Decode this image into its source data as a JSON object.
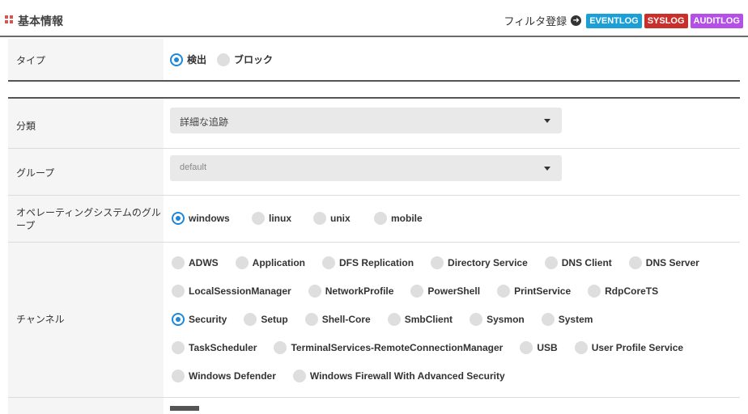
{
  "header": {
    "title": "基本情報",
    "filter_link": "フィルタ登録",
    "badges": [
      "EVENTLOG",
      "SYSLOG",
      "AUDITLOG"
    ]
  },
  "type_row": {
    "label": "タイプ",
    "options": [
      {
        "label": "検出",
        "selected": true
      },
      {
        "label": "ブロック",
        "selected": false
      }
    ]
  },
  "category_row": {
    "label": "分類",
    "selected": "詳細な追跡"
  },
  "group_row": {
    "label": "グループ",
    "selected": "default"
  },
  "os_row": {
    "label_line1": "オペレーティングシステムのグル",
    "label_line2": "ープ",
    "options": [
      {
        "label": "windows",
        "selected": true
      },
      {
        "label": "linux",
        "selected": false
      },
      {
        "label": "unix",
        "selected": false
      },
      {
        "label": "mobile",
        "selected": false
      }
    ]
  },
  "channel_row": {
    "label": "チャンネル",
    "lines": [
      [
        {
          "label": "ADWS",
          "selected": false
        },
        {
          "label": "Application",
          "selected": false
        },
        {
          "label": "DFS Replication",
          "selected": false
        },
        {
          "label": "Directory Service",
          "selected": false
        },
        {
          "label": "DNS Client",
          "selected": false
        },
        {
          "label": "DNS Server",
          "selected": false
        }
      ],
      [
        {
          "label": "LocalSessionManager",
          "selected": false
        },
        {
          "label": "NetworkProfile",
          "selected": false
        },
        {
          "label": "PowerShell",
          "selected": false
        },
        {
          "label": "PrintService",
          "selected": false
        },
        {
          "label": "RdpCoreTS",
          "selected": false
        }
      ],
      [
        {
          "label": "Security",
          "selected": true
        },
        {
          "label": "Setup",
          "selected": false
        },
        {
          "label": "Shell-Core",
          "selected": false
        },
        {
          "label": "SmbClient",
          "selected": false
        },
        {
          "label": "Sysmon",
          "selected": false
        },
        {
          "label": "System",
          "selected": false
        }
      ],
      [
        {
          "label": "TaskScheduler",
          "selected": false
        },
        {
          "label": "TerminalServices-RemoteConnectionManager",
          "selected": false
        },
        {
          "label": "USB",
          "selected": false
        },
        {
          "label": "User Profile Service",
          "selected": false
        }
      ],
      [
        {
          "label": "Windows Defender",
          "selected": false
        },
        {
          "label": "Windows Firewall With Advanced Security",
          "selected": false
        }
      ]
    ]
  },
  "colors": {
    "accent": "#1e88d8",
    "eventlog": "#1a9fd6",
    "syslog": "#c9302c",
    "auditlog": "#b44fe8"
  }
}
